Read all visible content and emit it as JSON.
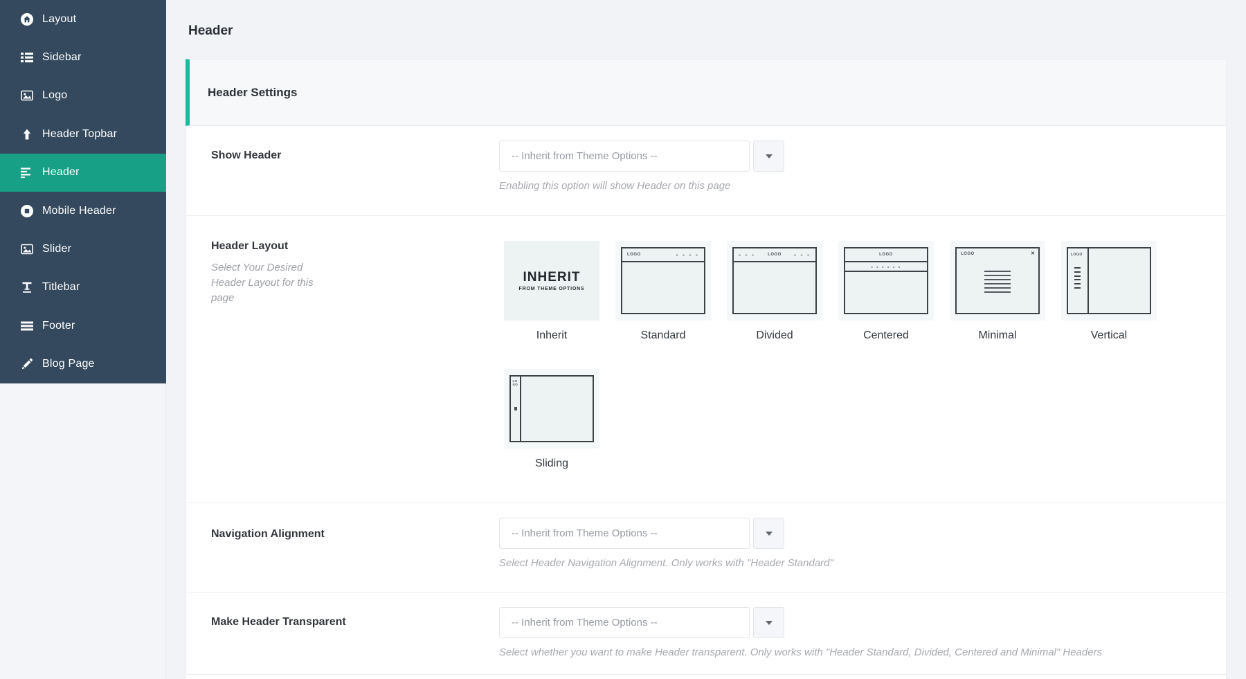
{
  "sidebar": {
    "items": [
      {
        "label": "Layout",
        "icon": "layout-icon"
      },
      {
        "label": "Sidebar",
        "icon": "sidebar-icon"
      },
      {
        "label": "Logo",
        "icon": "logo-icon"
      },
      {
        "label": "Header Topbar",
        "icon": "arrow-up-icon"
      },
      {
        "label": "Header",
        "icon": "align-left-icon",
        "active": true
      },
      {
        "label": "Mobile Header",
        "icon": "mobile-header-icon"
      },
      {
        "label": "Slider",
        "icon": "slider-icon"
      },
      {
        "label": "Titlebar",
        "icon": "titlebar-icon"
      },
      {
        "label": "Footer",
        "icon": "footer-icon"
      },
      {
        "label": "Blog Page",
        "icon": "pencil-icon"
      }
    ]
  },
  "page": {
    "title": "Header"
  },
  "panel": {
    "heading": "Header Settings",
    "accent_color": "#1abc9c",
    "active_item_color": "#17a085",
    "sidebar_color": "#34495e",
    "rows": {
      "show_header": {
        "label": "Show Header",
        "value": "-- Inherit from Theme Options --",
        "help": "Enabling this option will show Header on this page"
      },
      "header_layout": {
        "label": "Header Layout",
        "sublabel": "Select Your Desired Header Layout for this page",
        "layouts": [
          {
            "label": "Inherit"
          },
          {
            "label": "Standard"
          },
          {
            "label": "Divided"
          },
          {
            "label": "Centered"
          },
          {
            "label": "Minimal"
          },
          {
            "label": "Vertical"
          },
          {
            "label": "Sliding"
          }
        ]
      },
      "navigation_alignment": {
        "label": "Navigation Alignment",
        "value": "-- Inherit from Theme Options --",
        "help": "Select Header Navigation Alignment. Only works with \"Header Standard\""
      },
      "make_header_transparent": {
        "label": "Make Header Transparent",
        "value": "-- Inherit from Theme Options --",
        "help": "Select whether you want to make Header transparent. Only works with \"Header Standard, Divided, Centered and Minimal\" Headers"
      }
    },
    "thumbs": {
      "inherit_line1": "INHERIT",
      "inherit_line2": "FROM THEME OPTIONS",
      "logo": "LOGO",
      "close": "✕",
      "dash4": "- - - -",
      "dash3": "- - -",
      "dash6": "- - - - - -"
    }
  }
}
